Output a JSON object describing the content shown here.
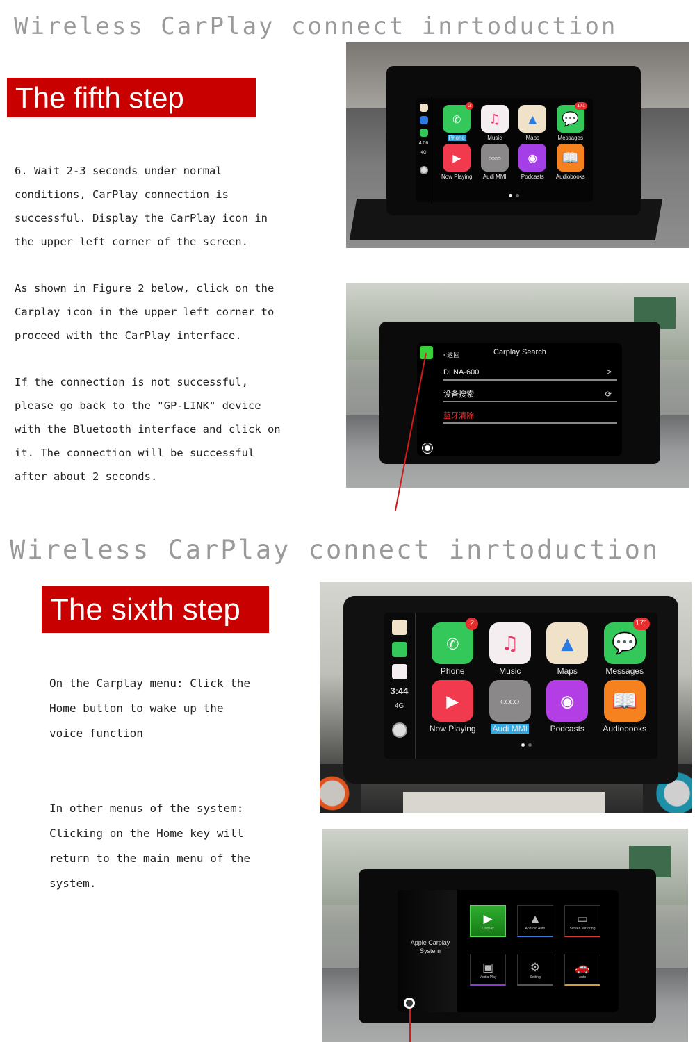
{
  "colors": {
    "title_gray": "#9a9a9a",
    "banner_red": "#c80000",
    "banner_text": "#ffffff",
    "body_text": "#222222",
    "arrow_red": "#d21a1a"
  },
  "section1": {
    "title": "Wireless CarPlay connect inrtoduction",
    "banner": "The fifth step",
    "paragraphs": [
      [
        "6. Wait 2-3 seconds under normal",
        "conditions, CarPlay connection is",
        "successful. Display the CarPlay icon in",
        "the upper left corner of the screen."
      ],
      [
        "As shown in Figure 2 below, click on the",
        "Carplay icon in the upper left corner to",
        "proceed with the CarPlay interface."
      ],
      [
        "If the connection is not successful,",
        "please go back to the \"GP-LINK\" device",
        "with the Bluetooth interface and click on",
        "it. The connection will be successful",
        "after about 2 seconds."
      ]
    ],
    "photo1": {
      "status_time": "4:06",
      "status_network": "4G",
      "apps": [
        {
          "label": "Phone",
          "icon": "phone-icon",
          "color": "#34c759",
          "badge": "2",
          "selected": true
        },
        {
          "label": "Music",
          "icon": "music-icon",
          "color": "#f4eef0",
          "badge": "",
          "selected": false
        },
        {
          "label": "Maps",
          "icon": "maps-icon",
          "color": "#f0e2c8",
          "badge": "",
          "selected": false
        },
        {
          "label": "Messages",
          "icon": "messages-icon",
          "color": "#34c759",
          "badge": "171",
          "selected": false
        },
        {
          "label": "Now Playing",
          "icon": "play-icon",
          "color": "#f23a4f",
          "badge": "",
          "selected": false
        },
        {
          "label": "Audi MMI",
          "icon": "audi-rings-icon",
          "color": "#8a8888",
          "badge": "",
          "selected": false
        },
        {
          "label": "Podcasts",
          "icon": "podcasts-icon",
          "color": "#a43ee6",
          "badge": "",
          "selected": false
        },
        {
          "label": "Audiobooks",
          "icon": "book-icon",
          "color": "#f5821f",
          "badge": "",
          "selected": false
        }
      ]
    },
    "photo2": {
      "back_label": "<返回",
      "screen_title": "Carplay Search",
      "rows": [
        {
          "label": "DLNA-600",
          "trailing": ">",
          "color": "#eeeeee"
        },
        {
          "label": "设备搜索",
          "trailing": "⟳",
          "color": "#eeeeee"
        },
        {
          "label": "蓝牙清除",
          "trailing": "",
          "color": "#e03030"
        }
      ]
    }
  },
  "section2": {
    "title": "Wireless CarPlay connect inrtoduction",
    "banner": "The sixth step",
    "paragraphs": [
      [
        "On the Carplay menu: Click the",
        "Home button to wake up the",
        "voice function"
      ],
      [
        "In other menus of the system:",
        "Clicking on the Home key will",
        "return to the main menu of the",
        "system."
      ]
    ],
    "photo3": {
      "status_time": "3:44",
      "status_network": "4G",
      "apps": [
        {
          "label": "Phone",
          "icon": "phone-icon",
          "color": "#34c759",
          "badge": "2",
          "selected": false
        },
        {
          "label": "Music",
          "icon": "music-icon",
          "color": "#f4eef0",
          "badge": "",
          "selected": false
        },
        {
          "label": "Maps",
          "icon": "maps-icon",
          "color": "#f0e2c8",
          "badge": "",
          "selected": false
        },
        {
          "label": "Messages",
          "icon": "messages-icon",
          "color": "#34c759",
          "badge": "171",
          "selected": false
        },
        {
          "label": "Now Playing",
          "icon": "play-icon",
          "color": "#f23a4f",
          "badge": "",
          "selected": false
        },
        {
          "label": "Audi MMI",
          "icon": "audi-rings-icon",
          "color": "#8a8888",
          "badge": "",
          "selected": true
        },
        {
          "label": "Podcasts",
          "icon": "podcasts-icon",
          "color": "#b43ee6",
          "badge": "",
          "selected": false
        },
        {
          "label": "Audiobooks",
          "icon": "book-icon",
          "color": "#f5821f",
          "badge": "",
          "selected": false
        }
      ]
    },
    "photo4": {
      "system_label_1": "Apple Carplay",
      "system_label_2": "System",
      "tiles": [
        {
          "label": "Carplay",
          "icon": "carplay-play-icon",
          "underline": "#2fa82f",
          "active": true
        },
        {
          "label": "Android Auto",
          "icon": "android-auto-icon",
          "underline": "#3a7bd5",
          "active": false
        },
        {
          "label": "Screen Mirroring",
          "icon": "airplay-icon",
          "underline": "#d53a3a",
          "active": false
        },
        {
          "label": "Media Play",
          "icon": "video-icon",
          "underline": "#8a3ad5",
          "active": false
        },
        {
          "label": "Setting",
          "icon": "gear-icon",
          "underline": "#555555",
          "active": false
        },
        {
          "label": "Auto",
          "icon": "car-icon",
          "underline": "#d59a3a",
          "active": false
        }
      ]
    }
  }
}
